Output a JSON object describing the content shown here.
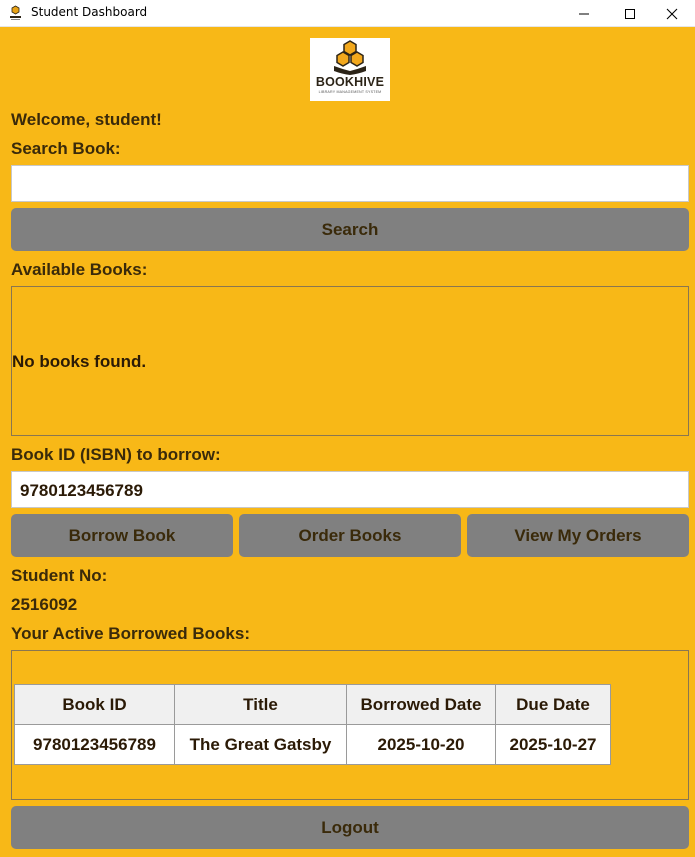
{
  "window": {
    "title": "Student Dashboard"
  },
  "logo": {
    "name": "BOOKHIVE",
    "tagline": "LIBRARY MANAGEMENT SYSTEM"
  },
  "welcome_text": "Welcome, student!",
  "search": {
    "label": "Search Book:",
    "value": "",
    "button_label": "Search"
  },
  "available_books": {
    "label": "Available Books:",
    "empty_message": "No books found."
  },
  "borrow": {
    "label": "Book ID (ISBN) to borrow:",
    "isbn_value": "9780123456789"
  },
  "actions": {
    "borrow_label": "Borrow Book",
    "order_label": "Order Books",
    "view_orders_label": "View My Orders"
  },
  "student": {
    "number_label": "Student No:",
    "number_value": "2516092"
  },
  "borrowed": {
    "label": "Your Active Borrowed Books:",
    "columns": [
      "Book ID",
      "Title",
      "Borrowed Date",
      "Due Date"
    ],
    "rows": [
      [
        "9780123456789",
        "The Great Gatsby",
        "2025-10-20",
        "2025-10-27"
      ]
    ]
  },
  "logout_label": "Logout",
  "colors": {
    "background": "#f8b817",
    "button": "#808080",
    "text": "#3a2a0a"
  }
}
